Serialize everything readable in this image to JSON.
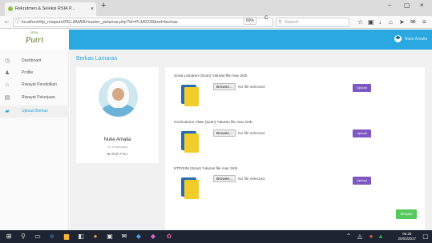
{
  "browser": {
    "tab_title": "Rekrutmen & Seleksi RSIA P...",
    "tab_close": "×",
    "new_tab": "+",
    "back": "←",
    "url": "localhost/itp_rsiaputri/PELAMAR/master_pelamar.php?id=PLM0228&nd=berkas",
    "zoom": "80%",
    "reload": "C",
    "search_placeholder": "Search",
    "window": {
      "minimize": "–",
      "maximize": "▢",
      "close": "×"
    },
    "toolbar_icons": [
      "star-icon",
      "clipboard-icon",
      "download-icon",
      "home-icon",
      "send-icon",
      "chat-icon",
      "menu-icon"
    ]
  },
  "header": {
    "logo_crest": "RSIA",
    "logo_text": "Putri",
    "username": "Nuke Amalia"
  },
  "sidebar": {
    "items": [
      {
        "label": "Dashboard",
        "icon": "clock-icon",
        "glyph": "◷"
      },
      {
        "label": "Profile",
        "icon": "user-icon",
        "glyph": "♟"
      },
      {
        "label": "Riwayat Pendidikan",
        "icon": "graduation-icon",
        "glyph": "⌂"
      },
      {
        "label": "Riwayat Pekerjaan",
        "icon": "document-icon",
        "glyph": "▤"
      },
      {
        "label": "Upload Berkas",
        "icon": "briefcase-icon",
        "glyph": "▰"
      }
    ],
    "active_index": 4
  },
  "main": {
    "title": "Berkas Lamaran",
    "profile": {
      "name": "Nuke Amalia",
      "department": "S1 Kesehatan",
      "change_photo": "Ubah Foto",
      "change_photo_icon": "camera-icon"
    },
    "uploads": [
      {
        "label": "Surat Lamaran (Scan) *ukuran file max 2mb",
        "browse": "Browse...",
        "no_file": "No file selected.",
        "button": "Upload"
      },
      {
        "label": "Curriculumn Vitae (Scan) *ukuran file max 2mb",
        "browse": "Browse...",
        "no_file": "No file selected.",
        "button": "Upload"
      },
      {
        "label": "KTP/SIM (Scan) *ukuran file max 2mb",
        "browse": "Browse...",
        "no_file": "No file selected.",
        "button": "Upload"
      }
    ],
    "save_button": "Simpan"
  },
  "taskbar": {
    "time": "05.28",
    "date": "20/03/2017"
  },
  "colors": {
    "primary": "#29a9e0",
    "upload": "#7e57c2",
    "save": "#55c95a",
    "doc_blue": "#2b6cb0",
    "doc_yellow": "#f1cd2b"
  }
}
